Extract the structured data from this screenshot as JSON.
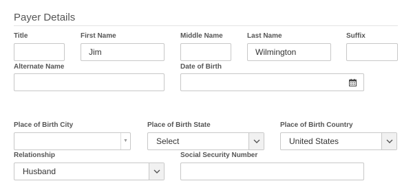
{
  "section": {
    "title": "Payer Details"
  },
  "fields": {
    "title": {
      "label": "Title",
      "value": ""
    },
    "first_name": {
      "label": "First Name",
      "value": "Jim"
    },
    "middle_name": {
      "label": "Middle Name",
      "value": ""
    },
    "last_name": {
      "label": "Last Name",
      "value": "Wilmington"
    },
    "suffix": {
      "label": "Suffix",
      "value": ""
    },
    "alternate_name": {
      "label": "Alternate Name",
      "value": ""
    },
    "date_of_birth": {
      "label": "Date of Birth",
      "value": "",
      "icon": "calendar-icon"
    },
    "place_of_birth_city": {
      "label": "Place of Birth City",
      "value": ""
    },
    "place_of_birth_state": {
      "label": "Place of Birth State",
      "value": "Select"
    },
    "place_of_birth_country": {
      "label": "Place of Birth Country",
      "value": "United States"
    },
    "relationship": {
      "label": "Relationship",
      "value": "Husband"
    },
    "ssn": {
      "label": "Social Security Number",
      "value": ""
    }
  },
  "colors": {
    "border": "#c7c7c7",
    "label": "#555555",
    "text": "#333333",
    "caret_bg": "#f1f1f1"
  }
}
